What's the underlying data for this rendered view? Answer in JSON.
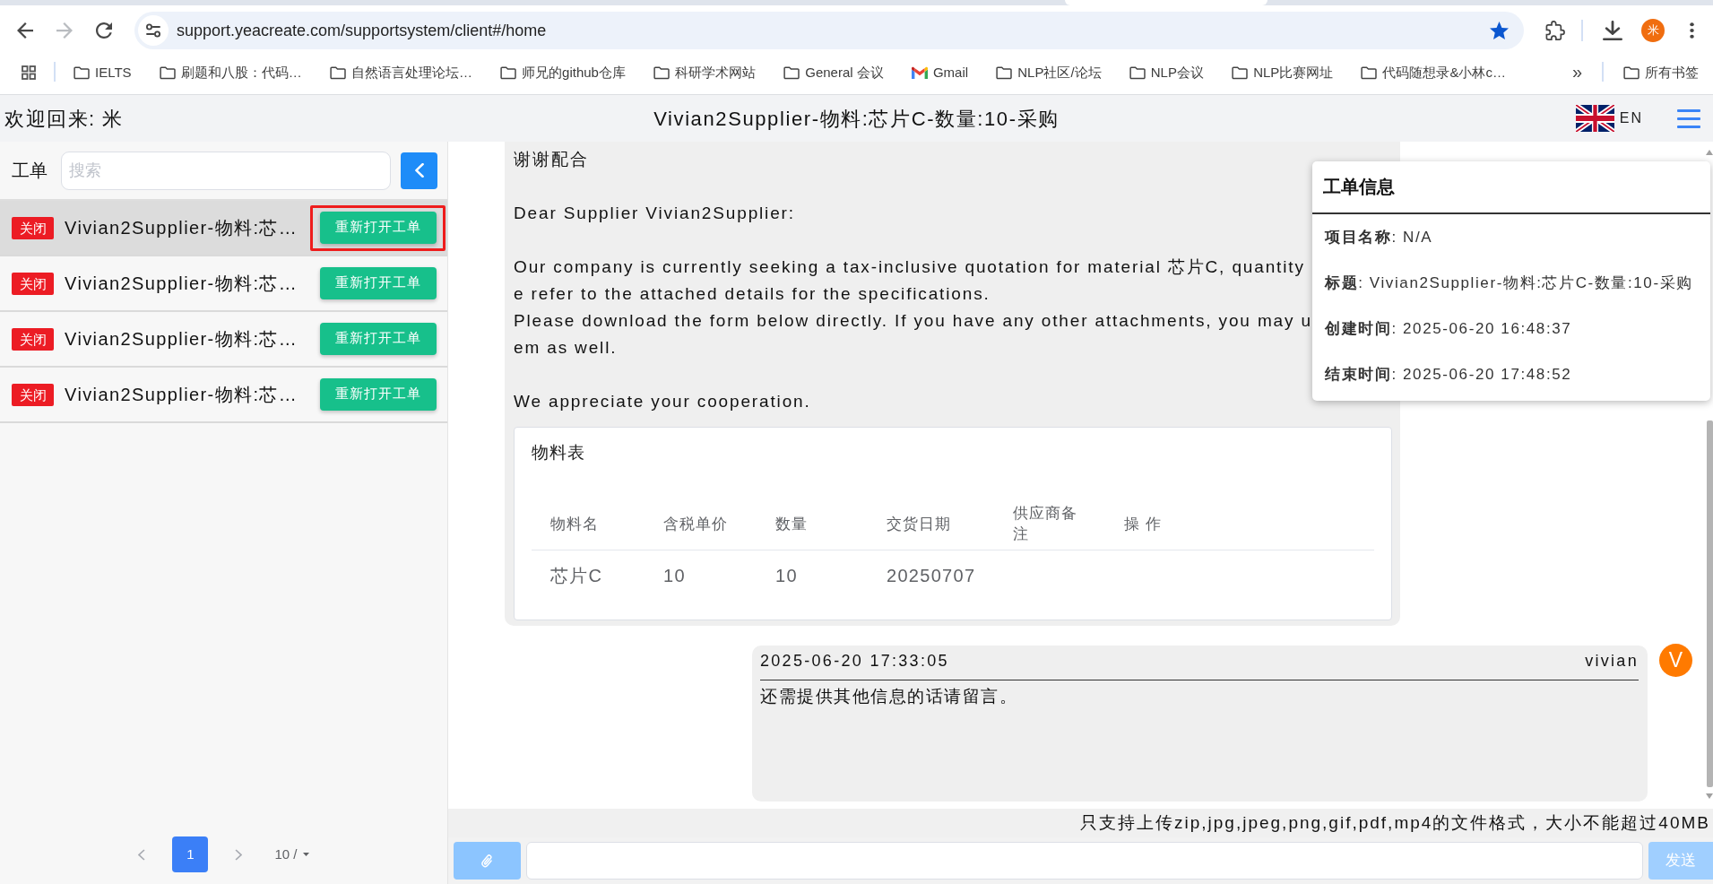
{
  "browser": {
    "nav": [
      {
        "kind": "back",
        "disabled": false
      },
      {
        "kind": "forward",
        "disabled": true
      },
      {
        "kind": "reload",
        "disabled": false
      }
    ],
    "url": "support.yeacreate.com/supportsystem/client#/home",
    "bookmarked": true,
    "profile_initial": "米",
    "bookmarks": [
      {
        "kind": "folder",
        "label": "IELTS"
      },
      {
        "kind": "folder",
        "label": "刷题和八股：代码…"
      },
      {
        "kind": "folder",
        "label": "自然语言处理论坛…"
      },
      {
        "kind": "folder",
        "label": "师兄的github仓库"
      },
      {
        "kind": "folder",
        "label": "科研学术网站"
      },
      {
        "kind": "folder",
        "label": "General 会议"
      },
      {
        "kind": "gmail",
        "label": "Gmail"
      },
      {
        "kind": "folder",
        "label": "NLP社区/论坛"
      },
      {
        "kind": "folder",
        "label": "NLP会议"
      },
      {
        "kind": "folder",
        "label": "NLP比赛网址"
      },
      {
        "kind": "folder",
        "label": "代码随想录&小林c…"
      }
    ],
    "more_bookmarks": "»",
    "all_bookmarks": "所有书签"
  },
  "header": {
    "welcome": "欢迎回来: 米",
    "title": "Vivian2Supplier-物料:芯片C-数量:10-采购",
    "language": "EN"
  },
  "sidebar": {
    "label": "工单",
    "search": {
      "placeholder": "搜索"
    },
    "tickets": [
      {
        "status": "关闭",
        "title": "Vivian2Supplier-物料:芯…",
        "action": "重新打开工单",
        "selected": true,
        "highlighted": true
      },
      {
        "status": "关闭",
        "title": "Vivian2Supplier-物料:芯…",
        "action": "重新打开工单",
        "selected": false,
        "highlighted": false
      },
      {
        "status": "关闭",
        "title": "Vivian2Supplier-物料:芯…",
        "action": "重新打开工单",
        "selected": false,
        "highlighted": false
      },
      {
        "status": "关闭",
        "title": "Vivian2Supplier-物料:芯…",
        "action": "重新打开工单",
        "selected": false,
        "highlighted": false
      }
    ],
    "pagination": {
      "pages": [
        {
          "label": "1",
          "selected": true
        }
      ],
      "page_size": "10 /"
    }
  },
  "messages": [
    {
      "kind": "mail",
      "paragraphs": [
        [
          "谢谢配合"
        ],
        [
          "Dear Supplier Vivian2Supplier:"
        ],
        [
          "Our company is currently seeking a tax-inclusive quotation for material 芯片C, quantity",
          "e refer to the attached details for the specifications.",
          "Please download the form below directly. If you have any other attachments, you may u",
          "em as well."
        ],
        [
          "We appreciate your cooperation."
        ]
      ],
      "material_table": {
        "title": "物料表",
        "columns": [
          "物料名",
          "含税单价",
          "数量",
          "交货日期",
          "供应商备注",
          "操 作"
        ],
        "rows": [
          [
            "芯片C",
            "10",
            "10",
            "20250707"
          ]
        ]
      }
    },
    {
      "kind": "reply",
      "time": "2025-06-20 17:33:05",
      "author": "vivian",
      "avatar": "V",
      "text": "还需提供其他信息的话请留言。"
    }
  ],
  "info_panel": {
    "title": "工单信息",
    "fields": [
      "**项目名称**: N/A",
      "**标题**: Vivian2Supplier-物料:芯片C-数量:10-采购",
      "**创建时间**: 2025-06-20 16:48:37",
      "**结束时间**: 2025-06-20 17:48:52"
    ]
  },
  "composer": {
    "note": "只支持上传zip,jpg,jpeg,png,gif,pdf,mp4的文件格式，大小不能超过40MB",
    "send": "发送",
    "disabled": true
  }
}
